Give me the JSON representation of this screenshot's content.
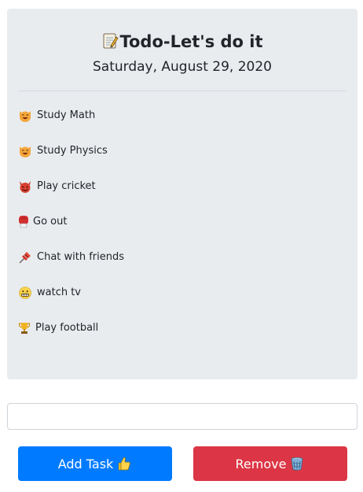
{
  "header": {
    "title": "Todo-Let's do it",
    "title_icon": "memo-icon",
    "date": "Saturday, August 29, 2020"
  },
  "tasks": [
    {
      "label": "Study Math",
      "icon": "grinning-cat-icon"
    },
    {
      "label": "Study Physics",
      "icon": "grinning-cat-icon"
    },
    {
      "label": "Play cricket",
      "icon": "devil-icon"
    },
    {
      "label": "Go out",
      "icon": "boxing-glove-icon"
    },
    {
      "label": "Chat with friends",
      "icon": "pushpin-icon"
    },
    {
      "label": "watch tv",
      "icon": "grimacing-face-icon"
    },
    {
      "label": "Play football",
      "icon": "trophy-icon"
    }
  ],
  "input": {
    "value": "",
    "placeholder": ""
  },
  "buttons": {
    "add_label": "Add Task",
    "add_icon": "thumbs-up-icon",
    "remove_label": "Remove",
    "remove_icon": "wastebasket-icon"
  },
  "colors": {
    "card_bg": "#e9ecef",
    "add_button": "#007bff",
    "remove_button": "#dc3545"
  }
}
